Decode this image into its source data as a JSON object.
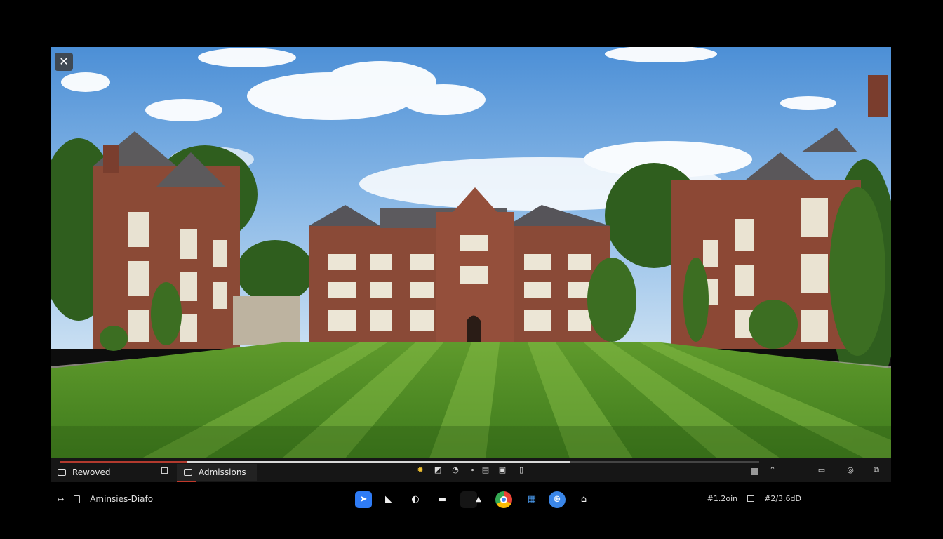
{
  "viewer": {
    "close_label": "✕",
    "progress_fraction": 0.73,
    "tabs": [
      {
        "label": "Rewoved",
        "active": false
      },
      {
        "label": "Admissions",
        "active": true
      }
    ],
    "toolbar_icons": [
      "sun-icon",
      "image-icon",
      "tag-icon",
      "link-icon",
      "grid-icon",
      "pdf-icon",
      "phone-icon"
    ],
    "right_icons": [
      "chevron-up-icon",
      "camera-icon",
      "circle-icon",
      "expand-icon"
    ]
  },
  "taskbar": {
    "left_label": "Aminsies-Diafo",
    "right_text_1": "#1.2oin",
    "right_text_2": "#2/3.6dD",
    "apps": [
      "start-icon",
      "folder-icon",
      "clock-icon",
      "window-icon",
      "dark-app-icon",
      "chrome-icon",
      "files-icon",
      "globe-icon",
      "store-icon"
    ]
  },
  "colors": {
    "accent": "#2f7cf6",
    "tab_underline": "#c0392b"
  }
}
